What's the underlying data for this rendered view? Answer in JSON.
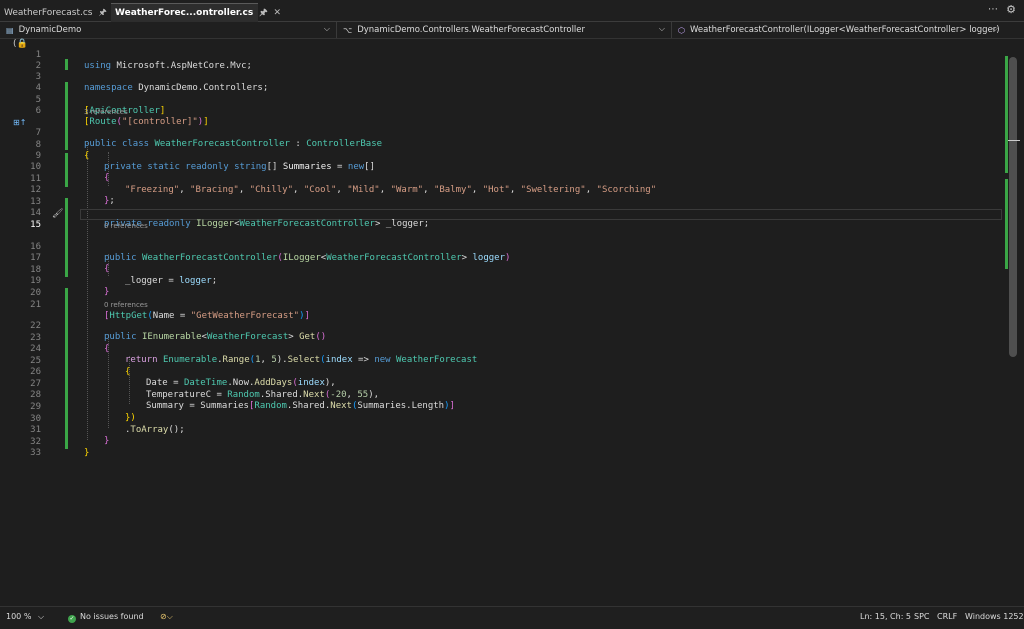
{
  "tabs": [
    {
      "label": "WeatherForecast.cs",
      "active": false,
      "pin_icon": "pin-icon",
      "close_icon": "close-icon"
    },
    {
      "label": "WeatherForec...ontroller.cs",
      "active": true,
      "pin_icon": "pin-icon",
      "close_icon": "close-icon"
    }
  ],
  "nav": {
    "project": "DynamicDemo",
    "scope": "DynamicDemo.Controllers.WeatherForecastController",
    "member": "WeatherForecastController(ILogger<WeatherForecastController> logger)"
  },
  "lens": {
    "three_refs": "3 references",
    "zero_refs_a": "0 references",
    "zero_refs_b": "0 references"
  },
  "code": {
    "l1": {
      "n": "1",
      "t1": "using",
      "t2": " Microsoft.AspNetCore.Mvc;"
    },
    "l2": {
      "n": "2"
    },
    "l3": {
      "n": "3",
      "t1": "namespace",
      "t2": " DynamicDemo.Controllers;"
    },
    "l4": {
      "n": "4"
    },
    "l5": {
      "n": "5",
      "t1": "[",
      "t2": "ApiController",
      "t3": "]"
    },
    "l6": {
      "n": "6",
      "t1": "[",
      "t2": "Route",
      "t3": "(",
      "t4": "\"[controller]\"",
      "t5": ")",
      "t6": "]"
    },
    "l7": {
      "n": "7",
      "t1": "public",
      "t2": " ",
      "t3": "class",
      "t4": " ",
      "t5": "WeatherForecastController",
      "t6": " : ",
      "t7": "ControllerBase"
    },
    "l8": {
      "n": "8",
      "t1": "{"
    },
    "l9": {
      "n": "9",
      "t1": "private",
      "t2": " ",
      "t3": "static",
      "t4": " ",
      "t5": "readonly",
      "t6": " ",
      "t7": "string",
      "t8": "[] ",
      "t9": "Summaries",
      "t10": " = ",
      "t11": "new",
      "t12": "[]"
    },
    "l10": {
      "n": "10",
      "t1": "{"
    },
    "l11": {
      "n": "11",
      "t1": "\"Freezing\"",
      "t2": ", ",
      "t3": "\"Bracing\"",
      "t4": ", ",
      "t5": "\"Chilly\"",
      "t6": ", ",
      "t7": "\"Cool\"",
      "t8": ", ",
      "t9": "\"Mild\"",
      "t10": ", ",
      "t11": "\"Warm\"",
      "t12": ", ",
      "t13": "\"Balmy\"",
      "t14": ", ",
      "t15": "\"Hot\"",
      "t16": ", ",
      "t17": "\"Sweltering\"",
      "t18": ", ",
      "t19": "\"Scorching\""
    },
    "l12": {
      "n": "12",
      "t1": "}",
      "t2": ";"
    },
    "l13": {
      "n": "13"
    },
    "l14": {
      "n": "14",
      "t1": "private",
      "t2": " ",
      "t3": "readonly",
      "t4": " ",
      "t5": "ILogger",
      "t6": "<",
      "t7": "WeatherForecastController",
      "t8": "> ",
      "t9": "_logger",
      "t10": ";"
    },
    "l15": {
      "n": "15"
    },
    "l16": {
      "n": "16",
      "t1": "public",
      "t2": " ",
      "t3": "WeatherForecastController",
      "t4": "(",
      "t5": "ILogger",
      "t6": "<",
      "t7": "WeatherForecastController",
      "t8": "> ",
      "t9": "logger",
      "t10": ")"
    },
    "l17": {
      "n": "17",
      "t1": "{"
    },
    "l18": {
      "n": "18",
      "t1": "_logger",
      "t2": " = ",
      "t3": "logger",
      "t4": ";"
    },
    "l19": {
      "n": "19",
      "t1": "}"
    },
    "l20": {
      "n": "20"
    },
    "l21": {
      "n": "21",
      "t1": "[",
      "t2": "HttpGet",
      "t3": "(",
      "t4": "Name",
      "t5": " = ",
      "t6": "\"GetWeatherForecast\"",
      "t7": ")",
      "t8": "]"
    },
    "l22": {
      "n": "22",
      "t1": "public",
      "t2": " ",
      "t3": "IEnumerable",
      "t4": "<",
      "t5": "WeatherForecast",
      "t6": "> ",
      "t7": "Get",
      "t8": "()"
    },
    "l23": {
      "n": "23",
      "t1": "{"
    },
    "l24": {
      "n": "24",
      "t1": "return",
      "t2": " ",
      "t3": "Enumerable",
      "t4": ".",
      "t5": "Range",
      "t6": "(",
      "t7": "1",
      "t8": ", ",
      "t9": "5",
      "t10": ").",
      "t11": "Select",
      "t12": "(",
      "t13": "index",
      "t14": " => ",
      "t15": "new",
      "t16": " ",
      "t17": "WeatherForecast"
    },
    "l25": {
      "n": "25",
      "t1": "{"
    },
    "l26": {
      "n": "26",
      "t1": "Date",
      "t2": " = ",
      "t3": "DateTime",
      "t4": ".",
      "t5": "Now",
      "t6": ".",
      "t7": "AddDays",
      "t8": "(",
      "t9": "index",
      "t10": "),"
    },
    "l27": {
      "n": "27",
      "t1": "TemperatureC",
      "t2": " = ",
      "t3": "Random",
      "t4": ".",
      "t5": "Shared",
      "t6": ".",
      "t7": "Next",
      "t8": "(",
      "t9": "-20",
      "t10": ", ",
      "t11": "55",
      "t12": "),"
    },
    "l28": {
      "n": "28",
      "t1": "Summary",
      "t2": " = ",
      "t3": "Summaries",
      "t4": "[",
      "t5": "Random",
      "t6": ".",
      "t7": "Shared",
      "t8": ".",
      "t9": "Next",
      "t10": "(",
      "t11": "Summaries",
      "t12": ".",
      "t13": "Length",
      "t14": ")",
      "t15": "]"
    },
    "l29": {
      "n": "29",
      "t1": "})"
    },
    "l30": {
      "n": "30",
      "t1": ".",
      "t2": "ToArray",
      "t3": "();"
    },
    "l31": {
      "n": "31",
      "t1": "}"
    },
    "l32": {
      "n": "32",
      "t1": "}"
    },
    "l33": {
      "n": "33"
    }
  },
  "status": {
    "zoom": "100 %",
    "issues": "No issues found",
    "position": "Ln: 15, Ch: 5",
    "whitespace": "SPC",
    "line_ending": "CRLF",
    "encoding": "Windows 1252"
  },
  "colors": {
    "keyword": "#569cd6",
    "type": "#4ec9b0",
    "string": "#d69d85",
    "method": "#dcdcaa",
    "number": "#b5cea8",
    "control": "#d8a0df",
    "parameter": "#9cdcfe",
    "change_marker": "#3aa646"
  },
  "icons": [
    "pin-icon",
    "close-icon",
    "overflow-menu-icon",
    "settings-gear-icon",
    "project-icon",
    "namespace-icon",
    "method-icon",
    "chevron-down-icon",
    "lock-icon",
    "implementation-glyph-icon",
    "quick-actions-icon",
    "issues-check-icon",
    "cleanup-broom-icon"
  ]
}
